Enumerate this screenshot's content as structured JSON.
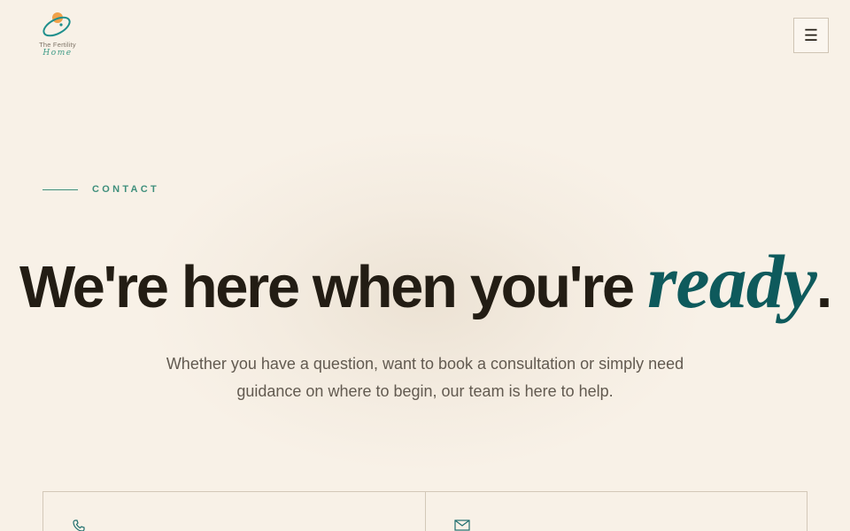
{
  "header": {
    "logo": {
      "line1": "The Fertility",
      "line2": "Home"
    },
    "menu_icon": "hamburger-menu-icon",
    "menu_glyph": "☰"
  },
  "hero": {
    "eyebrow": "CONTACT",
    "headline_main": "We're here when you're",
    "headline_accent": "ready",
    "headline_end": ".",
    "subtitle": "Whether you have a question, want to book a consultation or simply need guidance on where to begin, our team is here to help."
  },
  "contact_cards": [
    {
      "icon": "phone-icon"
    },
    {
      "icon": "mail-icon"
    }
  ],
  "colors": {
    "background": "#f8f1e7",
    "accent_teal": "#0e5a5c",
    "eyebrow_green": "#3f8f7c",
    "text_dark": "#231d14",
    "logo_orange": "#f0a14a"
  }
}
